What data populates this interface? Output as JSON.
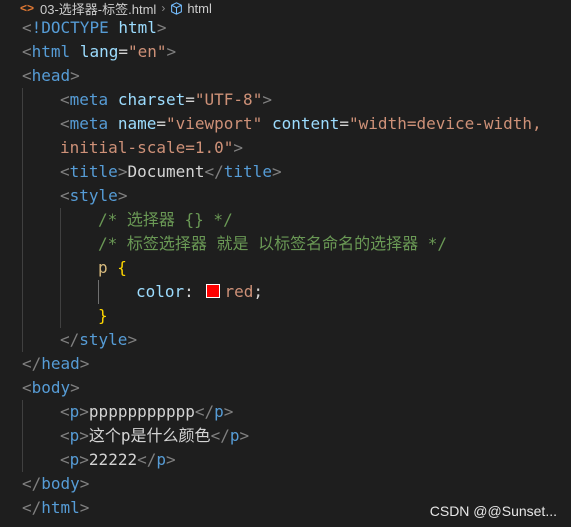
{
  "breadcrumb": {
    "file_icon": "<>",
    "file_name": "03-选择器-标签.html",
    "separator": "›",
    "symbol_icon": "cube-icon",
    "symbol_name": "html"
  },
  "code": {
    "line1": {
      "open": "<",
      "doctype": "!DOCTYPE",
      "sp": " ",
      "html": "html",
      "close": ">"
    },
    "line2": {
      "open": "<",
      "tag": "html",
      "sp": " ",
      "attr": "lang",
      "eq": "=",
      "val": "\"en\"",
      "close": ">"
    },
    "line3": {
      "open": "<",
      "tag": "head",
      "close": ">"
    },
    "line4": {
      "open": "<",
      "tag": "meta",
      "sp": " ",
      "attr": "charset",
      "eq": "=",
      "val": "\"UTF-8\"",
      "close": ">"
    },
    "line5": {
      "open": "<",
      "tag": "meta",
      "sp": " ",
      "attr1": "name",
      "eq1": "=",
      "val1": "\"viewport\"",
      "sp2": " ",
      "attr2": "content",
      "eq2": "=",
      "val2a": "\"width=device-width,"
    },
    "line6": {
      "val2b": "initial-scale=1.0\"",
      "close": ">"
    },
    "line7": {
      "open": "<",
      "tag": "title",
      "close": ">",
      "text": "Document",
      "open2": "</",
      "tag2": "title",
      "close2": ">"
    },
    "line8": {
      "open": "<",
      "tag": "style",
      "close": ">"
    },
    "line9": {
      "comment": "/* 选择器 {} */"
    },
    "line10": {
      "comment": "/* 标签选择器 就是 以标签名命名的选择器 */"
    },
    "line11": {
      "selector": "p",
      "sp": " ",
      "brace": "{"
    },
    "line12": {
      "prop": "color",
      "colon": ": ",
      "value": "red",
      "semi": ";",
      "swatch_color": "#ff0000"
    },
    "line13": {
      "brace": "}"
    },
    "line14": {
      "open": "</",
      "tag": "style",
      "close": ">"
    },
    "line15": {
      "open": "</",
      "tag": "head",
      "close": ">"
    },
    "line16": {
      "open": "<",
      "tag": "body",
      "close": ">"
    },
    "line17": {
      "open": "<",
      "tag": "p",
      "close": ">",
      "text": "ppppppppppp",
      "open2": "</",
      "tag2": "p",
      "close2": ">"
    },
    "line18": {
      "open": "<",
      "tag": "p",
      "close": ">",
      "text": "这个p是什么颜色",
      "open2": "</",
      "tag2": "p",
      "close2": ">"
    },
    "line19": {
      "open": "<",
      "tag": "p",
      "close": ">",
      "text": "22222",
      "open2": "</",
      "tag2": "p",
      "close2": ">"
    },
    "line20": {
      "open": "</",
      "tag": "body",
      "close": ">"
    },
    "line21": {
      "open": "</",
      "tag": "html",
      "close": ">"
    }
  },
  "watermark": "CSDN @@Sunset..."
}
